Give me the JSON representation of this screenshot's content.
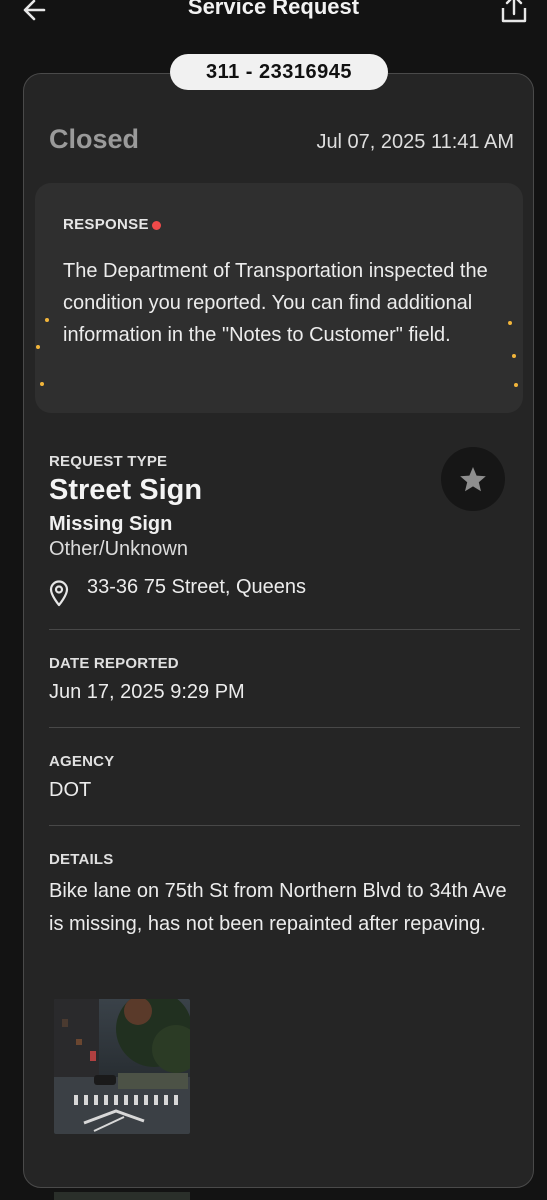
{
  "header": {
    "title": "Service Request"
  },
  "request": {
    "number": "311 - 23316945",
    "status": "Closed",
    "status_date": "Jul 07, 2025 11:41 AM"
  },
  "response": {
    "label": "RESPONSE",
    "text": "The Department of Transportation inspected the condition you reported. You can find additional information in the \"Notes to Customer\" field."
  },
  "request_type": {
    "label": "REQUEST TYPE",
    "main": "Street Sign",
    "sub": "Missing Sign",
    "sub2": "Other/Unknown",
    "address": "33-36 75 Street, Queens"
  },
  "date_reported": {
    "label": "DATE REPORTED",
    "value": "Jun 17, 2025 9:29 PM"
  },
  "agency": {
    "label": "AGENCY",
    "value": "DOT"
  },
  "details": {
    "label": "DETAILS",
    "text": "Bike lane on 75th St from Northern Blvd to 34th Ave is missing, has not been repainted after repaving."
  },
  "icons": {
    "back": "arrow-left-icon",
    "share": "share-icon",
    "favorite": "star-icon",
    "location": "location-pin-icon"
  },
  "colors": {
    "background": "#131313",
    "card": "#252525",
    "response_bg": "#2f2f2f",
    "status": "#9a9a9a",
    "dot": "#ef4a4a"
  }
}
